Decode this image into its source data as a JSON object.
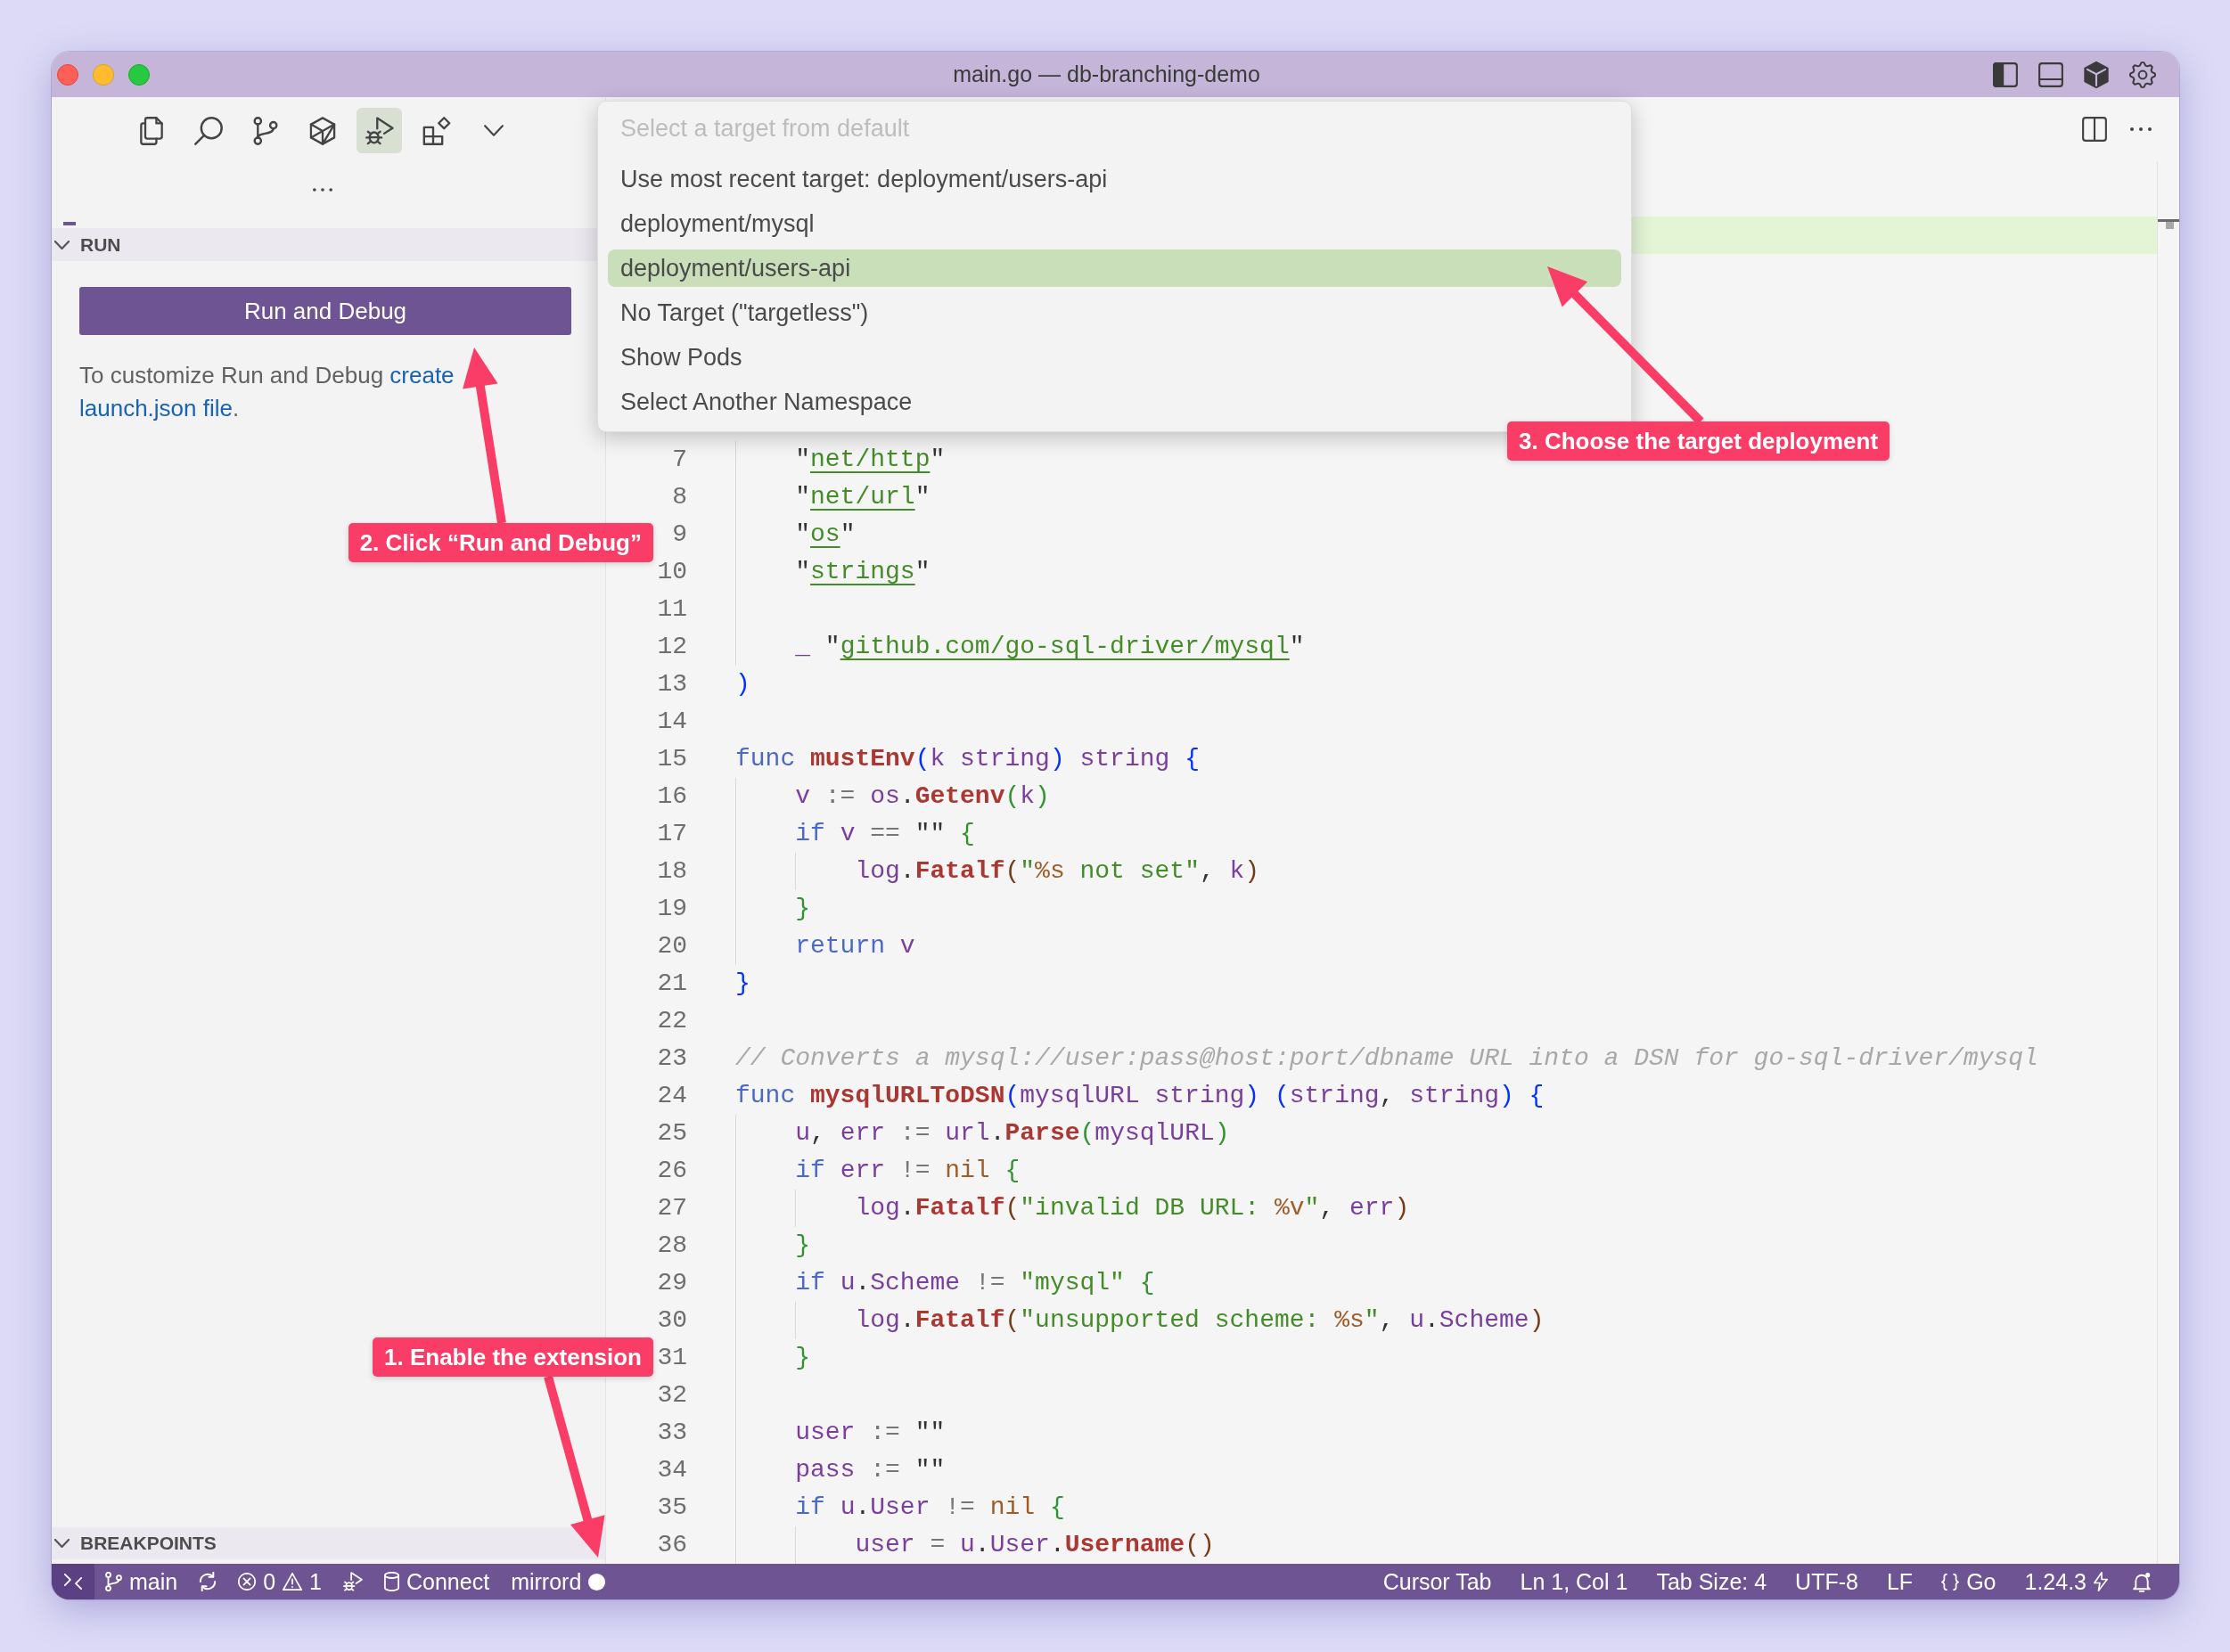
{
  "window": {
    "title": "main.go — db-branching-demo"
  },
  "activity_bar": [
    {
      "selected": false
    },
    {
      "selected": false
    },
    {
      "selected": false
    },
    {
      "selected": false
    },
    {
      "selected": true
    },
    {
      "selected": false
    }
  ],
  "sidebar": {
    "sections": [
      {
        "title": "RUN",
        "expanded": true
      },
      {
        "title": "BREAKPOINTS",
        "expanded": true
      }
    ],
    "run_button": "Run and Debug",
    "hint": {
      "text": "To customize Run and Debug",
      "links": [
        "create",
        "launch.json file"
      ],
      "end": "."
    }
  },
  "quick_pick": {
    "placeholder": "Select a target from default",
    "items": [
      {
        "label": "Use most recent target: deployment/users-api",
        "selected": false
      },
      {
        "label": "deployment/mysql",
        "selected": false
      },
      {
        "label": "deployment/users-api",
        "selected": true
      },
      {
        "label": "No Target (\"targetless\")",
        "selected": false
      },
      {
        "label": "Show Pods",
        "selected": false
      },
      {
        "label": "Select Another Namespace",
        "selected": false
      }
    ]
  },
  "editor": {
    "lines": [
      {
        "number": "7",
        "tokens": [
          {
            "kind": "plain",
            "text": "    \""
          },
          {
            "kind": "path",
            "text": "net/http"
          },
          {
            "kind": "plain",
            "text": "\""
          }
        ]
      },
      {
        "number": "8",
        "tokens": [
          {
            "kind": "plain",
            "text": "    \""
          },
          {
            "kind": "path",
            "text": "net/url"
          },
          {
            "kind": "plain",
            "text": "\""
          }
        ]
      },
      {
        "number": "9",
        "tokens": [
          {
            "kind": "plain",
            "text": "    \""
          },
          {
            "kind": "path",
            "text": "os"
          },
          {
            "kind": "plain",
            "text": "\""
          }
        ]
      },
      {
        "number": "10",
        "tokens": [
          {
            "kind": "plain",
            "text": "    \""
          },
          {
            "kind": "path",
            "text": "strings"
          },
          {
            "kind": "plain",
            "text": "\""
          }
        ]
      },
      {
        "number": "11"
      },
      {
        "number": "12",
        "tokens": [
          {
            "kind": "var",
            "text": "    _"
          },
          {
            "kind": "plain",
            "text": " \""
          },
          {
            "kind": "path",
            "text": "github.com/go-sql-driver/mysql"
          },
          {
            "kind": "plain",
            "text": "\""
          }
        ]
      },
      {
        "number": "13",
        "tokens": [
          {
            "kind": "b1",
            "text": ")"
          }
        ]
      },
      {
        "number": "14"
      },
      {
        "number": "15",
        "tokens": [
          {
            "kind": "kw",
            "text": "func "
          },
          {
            "kind": "fn",
            "text": "mustEnv"
          },
          {
            "kind": "b1",
            "text": "("
          },
          {
            "kind": "var",
            "text": "k "
          },
          {
            "kind": "type",
            "text": "string"
          },
          {
            "kind": "b1",
            "text": ")"
          },
          {
            "kind": "type",
            "text": " string "
          },
          {
            "kind": "b1",
            "text": "{"
          }
        ]
      },
      {
        "number": "16",
        "tokens": [
          {
            "kind": "var",
            "text": "    v"
          },
          {
            "kind": "op",
            "text": " := "
          },
          {
            "kind": "var",
            "text": "os"
          },
          {
            "kind": "plain",
            "text": "."
          },
          {
            "kind": "fn",
            "text": "Getenv"
          },
          {
            "kind": "b2",
            "text": "("
          },
          {
            "kind": "var",
            "text": "k"
          },
          {
            "kind": "b2",
            "text": ")"
          }
        ]
      },
      {
        "number": "17",
        "tokens": [
          {
            "kind": "kw",
            "text": "    if "
          },
          {
            "kind": "var",
            "text": "v"
          },
          {
            "kind": "op",
            "text": " == "
          },
          {
            "kind": "plain",
            "text": "\"\" "
          },
          {
            "kind": "b2",
            "text": "{"
          }
        ]
      },
      {
        "number": "18",
        "tokens": [
          {
            "kind": "var",
            "text": "        log"
          },
          {
            "kind": "plain",
            "text": "."
          },
          {
            "kind": "fn",
            "text": "Fatalf"
          },
          {
            "kind": "b3",
            "text": "("
          },
          {
            "kind": "str",
            "text": "\""
          },
          {
            "kind": "fmt",
            "text": "%s"
          },
          {
            "kind": "str",
            "text": " not set\""
          },
          {
            "kind": "plain",
            "text": ", "
          },
          {
            "kind": "var",
            "text": "k"
          },
          {
            "kind": "b3",
            "text": ")"
          }
        ]
      },
      {
        "number": "19",
        "tokens": [
          {
            "kind": "b2",
            "text": "    }"
          }
        ]
      },
      {
        "number": "20",
        "tokens": [
          {
            "kind": "kw",
            "text": "    return "
          },
          {
            "kind": "var",
            "text": "v"
          }
        ]
      },
      {
        "number": "21",
        "tokens": [
          {
            "kind": "b1",
            "text": "}"
          }
        ]
      },
      {
        "number": "22"
      },
      {
        "number": "23",
        "tokens": [
          {
            "kind": "comment",
            "text": "// Converts a mysql://user:pass@host:port/dbname URL into a DSN for go-sql-driver/mysql"
          }
        ]
      },
      {
        "number": "24",
        "tokens": [
          {
            "kind": "kw",
            "text": "func "
          },
          {
            "kind": "fn",
            "text": "mysqlURLToDSN"
          },
          {
            "kind": "b1",
            "text": "("
          },
          {
            "kind": "var",
            "text": "mysqlURL "
          },
          {
            "kind": "type",
            "text": "string"
          },
          {
            "kind": "b1",
            "text": ") ("
          },
          {
            "kind": "type",
            "text": "string"
          },
          {
            "kind": "plain",
            "text": ", "
          },
          {
            "kind": "type",
            "text": "string"
          },
          {
            "kind": "b1",
            "text": ") {"
          }
        ]
      },
      {
        "number": "25",
        "tokens": [
          {
            "kind": "var",
            "text": "    u"
          },
          {
            "kind": "plain",
            "text": ", "
          },
          {
            "kind": "var",
            "text": "err"
          },
          {
            "kind": "op",
            "text": " := "
          },
          {
            "kind": "var",
            "text": "url"
          },
          {
            "kind": "plain",
            "text": "."
          },
          {
            "kind": "fn",
            "text": "Parse"
          },
          {
            "kind": "b2",
            "text": "("
          },
          {
            "kind": "var",
            "text": "mysqlURL"
          },
          {
            "kind": "b2",
            "text": ")"
          }
        ]
      },
      {
        "number": "26",
        "tokens": [
          {
            "kind": "kw",
            "text": "    if "
          },
          {
            "kind": "var",
            "text": "err"
          },
          {
            "kind": "op",
            "text": " != "
          },
          {
            "kind": "const",
            "text": "nil "
          },
          {
            "kind": "b2",
            "text": "{"
          }
        ]
      },
      {
        "number": "27",
        "tokens": [
          {
            "kind": "var",
            "text": "        log"
          },
          {
            "kind": "plain",
            "text": "."
          },
          {
            "kind": "fn",
            "text": "Fatalf"
          },
          {
            "kind": "b3",
            "text": "("
          },
          {
            "kind": "str",
            "text": "\"invalid DB URL: "
          },
          {
            "kind": "fmt",
            "text": "%v"
          },
          {
            "kind": "str",
            "text": "\""
          },
          {
            "kind": "plain",
            "text": ", "
          },
          {
            "kind": "var",
            "text": "err"
          },
          {
            "kind": "b3",
            "text": ")"
          }
        ]
      },
      {
        "number": "28",
        "tokens": [
          {
            "kind": "b2",
            "text": "    }"
          }
        ]
      },
      {
        "number": "29",
        "tokens": [
          {
            "kind": "kw",
            "text": "    if "
          },
          {
            "kind": "var",
            "text": "u"
          },
          {
            "kind": "plain",
            "text": "."
          },
          {
            "kind": "var",
            "text": "Scheme"
          },
          {
            "kind": "op",
            "text": " != "
          },
          {
            "kind": "str",
            "text": "\"mysql\" "
          },
          {
            "kind": "b2",
            "text": "{"
          }
        ]
      },
      {
        "number": "30",
        "tokens": [
          {
            "kind": "var",
            "text": "        log"
          },
          {
            "kind": "plain",
            "text": "."
          },
          {
            "kind": "fn",
            "text": "Fatalf"
          },
          {
            "kind": "b3",
            "text": "("
          },
          {
            "kind": "str",
            "text": "\"unsupported scheme: "
          },
          {
            "kind": "fmt",
            "text": "%s"
          },
          {
            "kind": "str",
            "text": "\""
          },
          {
            "kind": "plain",
            "text": ", "
          },
          {
            "kind": "var",
            "text": "u"
          },
          {
            "kind": "plain",
            "text": "."
          },
          {
            "kind": "var",
            "text": "Scheme"
          },
          {
            "kind": "b3",
            "text": ")"
          }
        ]
      },
      {
        "number": "31",
        "tokens": [
          {
            "kind": "b2",
            "text": "    }"
          }
        ]
      },
      {
        "number": "32"
      },
      {
        "number": "33",
        "tokens": [
          {
            "kind": "var",
            "text": "    user"
          },
          {
            "kind": "op",
            "text": " := "
          },
          {
            "kind": "plain",
            "text": "\"\""
          }
        ]
      },
      {
        "number": "34",
        "tokens": [
          {
            "kind": "var",
            "text": "    pass"
          },
          {
            "kind": "op",
            "text": " := "
          },
          {
            "kind": "plain",
            "text": "\"\""
          }
        ]
      },
      {
        "number": "35",
        "tokens": [
          {
            "kind": "kw",
            "text": "    if "
          },
          {
            "kind": "var",
            "text": "u"
          },
          {
            "kind": "plain",
            "text": "."
          },
          {
            "kind": "var",
            "text": "User"
          },
          {
            "kind": "op",
            "text": " != "
          },
          {
            "kind": "const",
            "text": "nil "
          },
          {
            "kind": "b2",
            "text": "{"
          }
        ]
      },
      {
        "number": "36",
        "tokens": [
          {
            "kind": "var",
            "text": "        user"
          },
          {
            "kind": "op",
            "text": " = "
          },
          {
            "kind": "var",
            "text": "u"
          },
          {
            "kind": "plain",
            "text": "."
          },
          {
            "kind": "var",
            "text": "User"
          },
          {
            "kind": "plain",
            "text": "."
          },
          {
            "kind": "fn",
            "text": "Username"
          },
          {
            "kind": "b3",
            "text": "()"
          }
        ]
      }
    ]
  },
  "status_bar": {
    "branch": "main",
    "errors": "0",
    "warnings": "1",
    "connect": "Connect",
    "mirrord": "mirrord",
    "cursor_tab": "Cursor Tab",
    "position": "Ln 1, Col 1",
    "indentation": "Tab Size: 4",
    "encoding": "UTF-8",
    "eol": "LF",
    "language": "Go",
    "go_version": "1.24.3"
  },
  "annotations": [
    {
      "text": "3. Choose the target deployment"
    },
    {
      "text": "2. Click “Run and Debug”"
    },
    {
      "text": "1. Enable the extension"
    }
  ]
}
